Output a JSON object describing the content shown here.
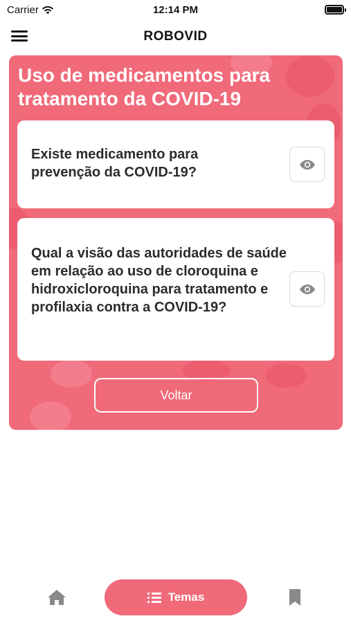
{
  "status_bar": {
    "carrier": "Carrier",
    "time": "12:14 PM"
  },
  "nav": {
    "title": "ROBOVID"
  },
  "panel": {
    "title": "Uso de medicamentos para tratamento da COVID-19",
    "questions": [
      {
        "text": "Existe medicamento para prevenção da COVID-19?"
      },
      {
        "text": "Qual a visão das autoridades de saúde em relação ao uso de cloroquina e hidroxicloroquina para tratamento e profilaxia contra a COVID-19?"
      }
    ],
    "back_button": "Voltar"
  },
  "tab_bar": {
    "temas_label": "Temas"
  },
  "colors": {
    "accent": "#f06a7a",
    "accent_dark": "#ea5366",
    "icon_gray": "#8a8a8a"
  }
}
